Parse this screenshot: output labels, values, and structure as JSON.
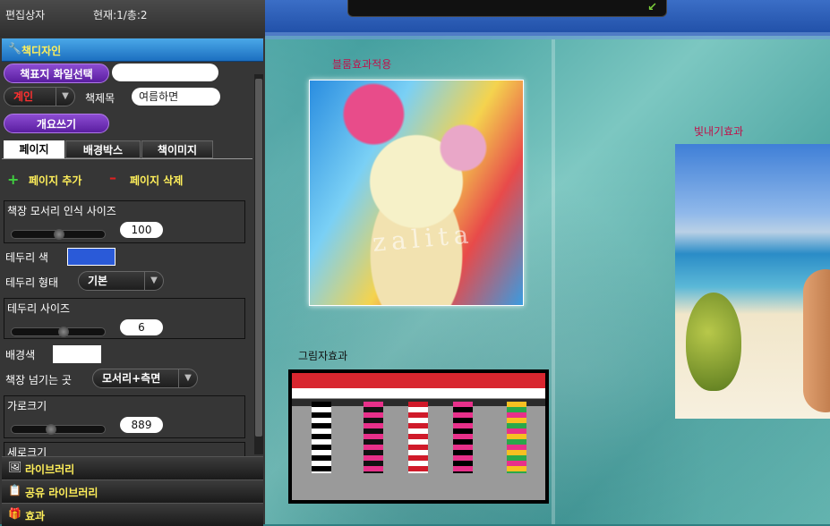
{
  "header": {
    "title": "편집상자",
    "page_info": "현재:1/총:2"
  },
  "design_section": {
    "label": "책디자인"
  },
  "cover_file_button": "책표지 화일선택",
  "cover_file_value": "",
  "color_select": {
    "value": "계인"
  },
  "book_title": {
    "label": "책제목",
    "value": "여름하면"
  },
  "summary_button": "개요쓰기",
  "tabs": [
    {
      "label": "페이지"
    },
    {
      "label": "배경박스"
    },
    {
      "label": "책이미지"
    }
  ],
  "page_actions": {
    "add": "페이지 추가",
    "delete": "페이지 삭제"
  },
  "corner_size": {
    "label": "책장 모서리 인식 사이즈",
    "value": "100",
    "fraction": 0.5
  },
  "border_color": {
    "label": "테두리 색",
    "color": "#2a5ad8"
  },
  "border_style": {
    "label": "테두리 형태",
    "value": "기본"
  },
  "border_size": {
    "label": "테두리 사이즈",
    "value": "6",
    "fraction": 0.55
  },
  "bg_color": {
    "label": "배경색",
    "color": "#ffffff"
  },
  "page_turn": {
    "label": "책장 넘기는 곳",
    "value": "모서리+측면"
  },
  "width": {
    "label": "가로크기",
    "value": "889",
    "fraction": 0.4
  },
  "height": {
    "label": "세로크기"
  },
  "bottom_sections": [
    {
      "label": "라이브러리"
    },
    {
      "label": "공유 라이브러리"
    },
    {
      "label": "효과"
    }
  ],
  "captions": {
    "blur": "블룸효과적용",
    "shadow": "그림자효과",
    "glow": "빛내기효과"
  },
  "watermark": "zalita",
  "colors": {
    "accent_purple": "#7a3cc4",
    "section_yellow": "#ffef5a",
    "caption_red": "#c0104a"
  }
}
